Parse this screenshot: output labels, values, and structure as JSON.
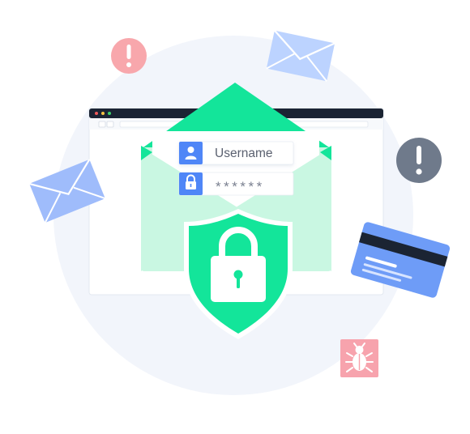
{
  "login": {
    "username_label": "Username",
    "password_mask": "******"
  },
  "icons": [
    "alert-icon-pink",
    "alert-icon-gray",
    "envelope-icon-top",
    "envelope-icon-left",
    "credit-card-icon",
    "bug-icon",
    "shield-lock-icon",
    "user-icon",
    "lock-small-icon"
  ],
  "colors": {
    "backdrop_circle": "#f2f5fb",
    "browser_bar": "#1b2433",
    "envelope_green": "#13e59a",
    "envelope_light": "#c9f7e2",
    "shield_green": "#13e59a",
    "field_icon_blue": "#4f86f7",
    "envelope_blue": "#bcd3ff",
    "card_blue": "#6e9cf7",
    "alert_pink": "#f8a7ac",
    "alert_gray": "#6f7a8b",
    "bug_pink": "#f7a3ad"
  }
}
